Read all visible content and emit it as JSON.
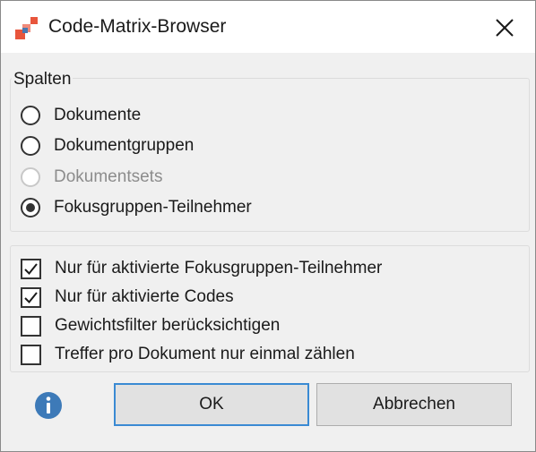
{
  "window": {
    "title": "Code-Matrix-Browser",
    "app_icon": "code-matrix-app-icon",
    "close_icon": "close-icon"
  },
  "columns_group": {
    "legend": "Spalten",
    "options": [
      {
        "label": "Dokumente",
        "selected": false,
        "enabled": true
      },
      {
        "label": "Dokumentgruppen",
        "selected": false,
        "enabled": true
      },
      {
        "label": "Dokumentsets",
        "selected": false,
        "enabled": false
      },
      {
        "label": "Fokusgruppen-Teilnehmer",
        "selected": true,
        "enabled": true
      }
    ]
  },
  "filters": [
    {
      "label": "Nur für aktivierte Fokusgruppen-Teilnehmer",
      "checked": true
    },
    {
      "label": "Nur für aktivierte Codes",
      "checked": true
    },
    {
      "label": "Gewichtsfilter berücksichtigen",
      "checked": false
    },
    {
      "label": "Treffer pro Dokument nur einmal zählen",
      "checked": false
    }
  ],
  "footer": {
    "info_icon": "info-icon",
    "ok_label": "OK",
    "cancel_label": "Abbrechen"
  },
  "colors": {
    "accent": "#3a8ad3",
    "info_icon": "#3d7ab8",
    "logo_red": "#e8553c",
    "logo_blue": "#4a78b0"
  }
}
